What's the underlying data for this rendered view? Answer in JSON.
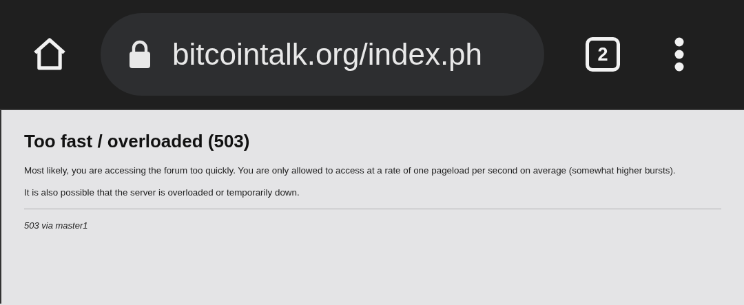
{
  "toolbar": {
    "url": "bitcointalk.org/index.ph",
    "tab_count": "2"
  },
  "page": {
    "title": "Too fast / overloaded (503)",
    "paragraphs": [
      "Most likely, you are accessing the forum too quickly. You are only allowed to access at a rate of one pageload per second on average (somewhat higher bursts).",
      "It is also possible that the server is overloaded or temporarily down."
    ],
    "footer": "503 via master1"
  }
}
